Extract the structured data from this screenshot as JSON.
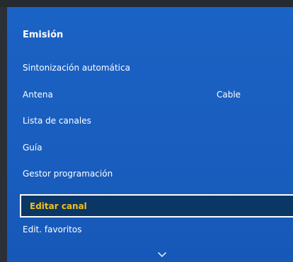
{
  "panel": {
    "title": "Emisión"
  },
  "menu": {
    "items": [
      {
        "label": "Sintonización automática",
        "value": ""
      },
      {
        "label": "Antena",
        "value": "Cable"
      },
      {
        "label": "Lista de canales",
        "value": ""
      },
      {
        "label": "Guía",
        "value": ""
      },
      {
        "label": "Gestor programación",
        "value": ""
      },
      {
        "label": "Editar canal",
        "value": "",
        "selected": true
      },
      {
        "label": "Edit. favoritos",
        "value": ""
      }
    ]
  },
  "icons": {
    "scroll_down": "chevron-down-icon"
  },
  "colors": {
    "panel_blue": "#1a5fc0",
    "selection_bg": "#0b3767",
    "selection_text": "#f2c01a",
    "text": "#ffffff"
  }
}
